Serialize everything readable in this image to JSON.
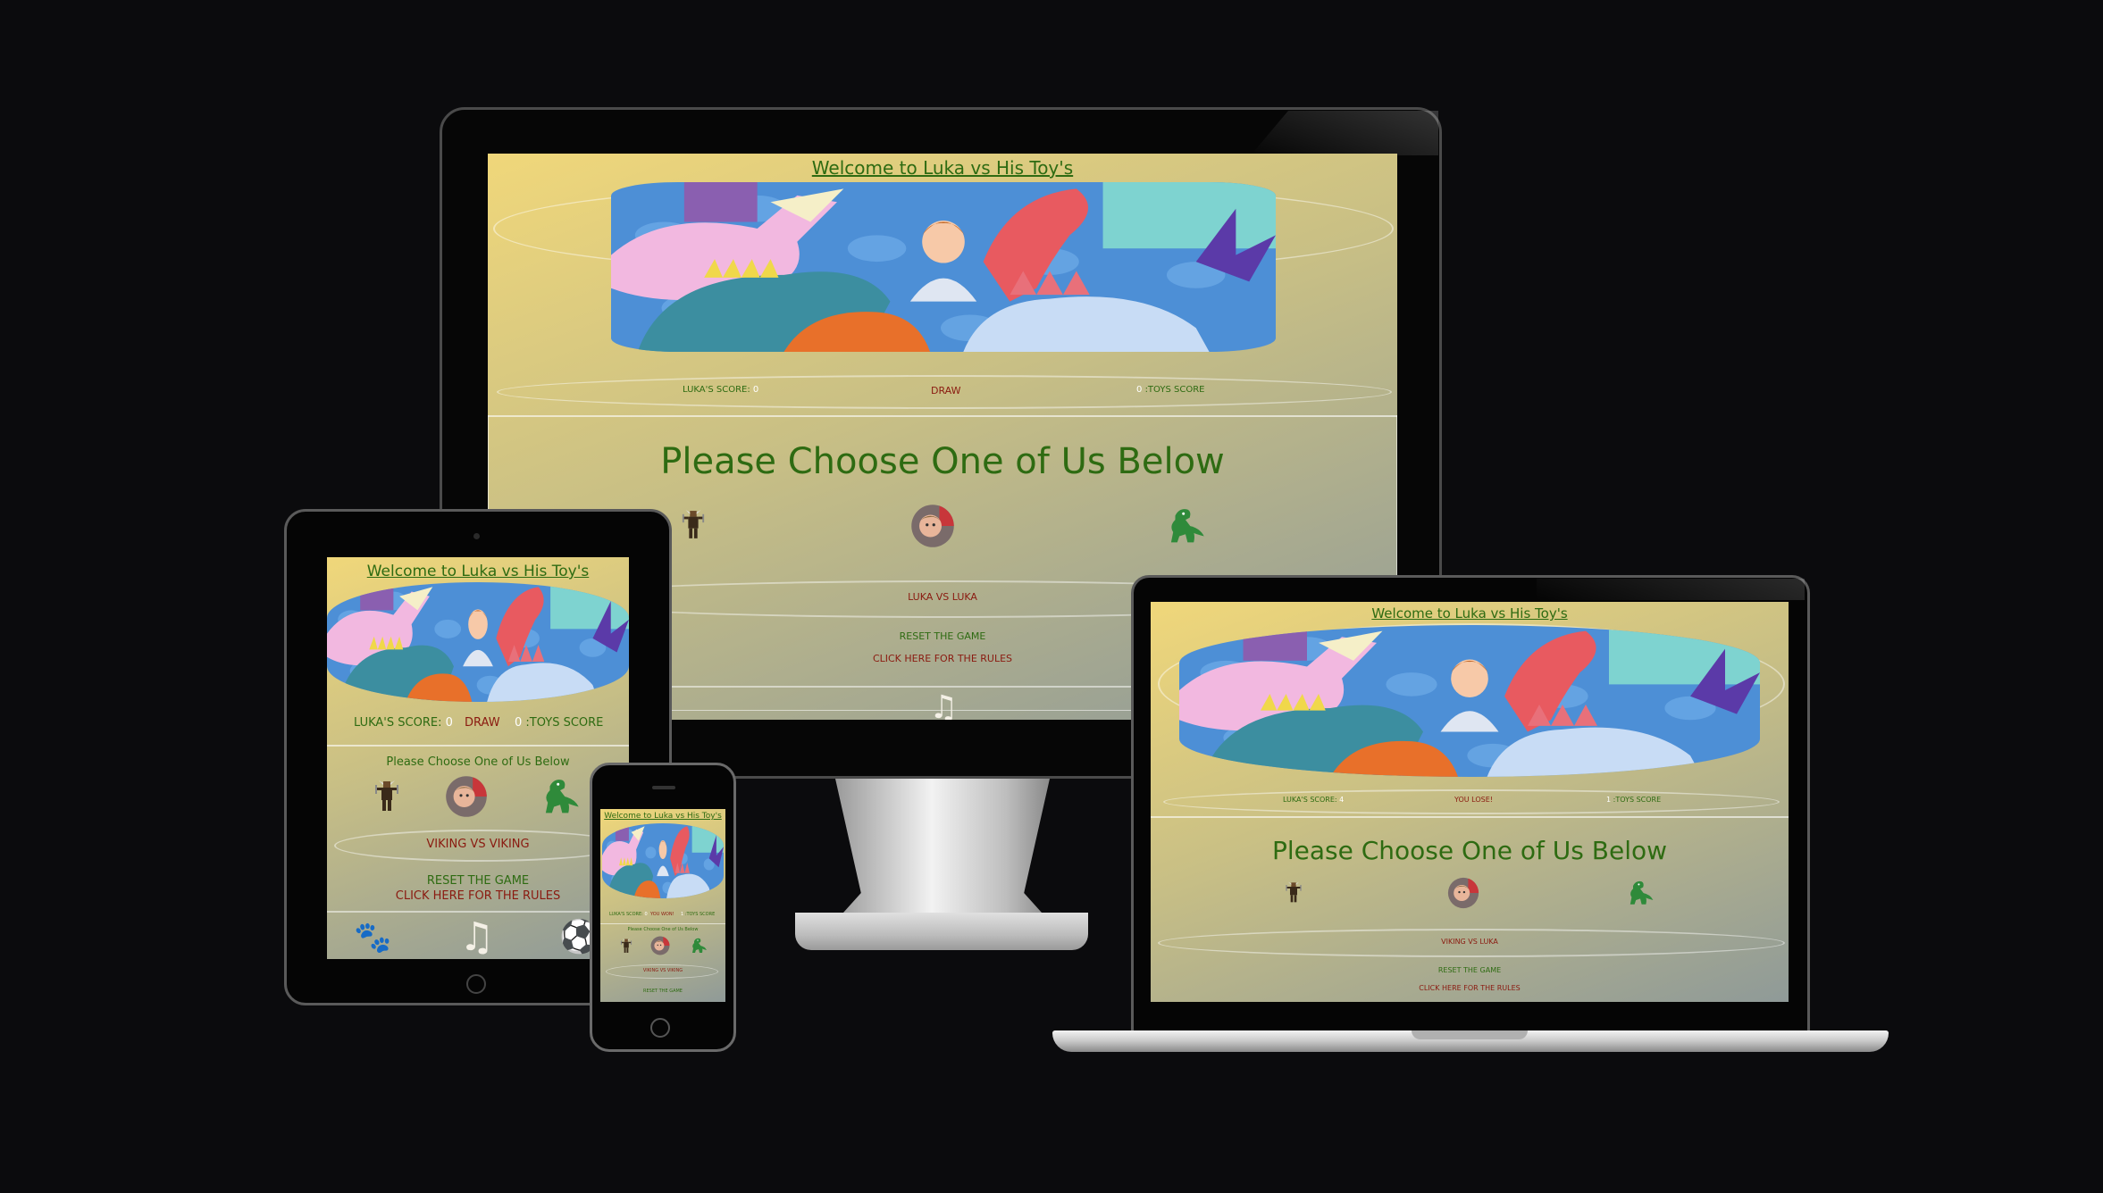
{
  "site": {
    "title": "Welcome to Luka vs His Toy's",
    "choose_heading": "Please Choose One of Us Below",
    "reset_label": "RESET THE GAME",
    "rules_label": "CLICK HERE FOR THE RULES",
    "lukas_score_label": "LUKA'S SCORE:",
    "toys_score_label": ":TOYS SCORE"
  },
  "desktop": {
    "lukas_score": "0",
    "result": "DRAW",
    "toys_score": "0",
    "matchup": "LUKA VS LUKA"
  },
  "tablet": {
    "lukas_score": "0",
    "result": "DRAW",
    "toys_score": "0",
    "matchup": "VIKING VS VIKING"
  },
  "laptop": {
    "lukas_score": "4",
    "result": "YOU LOSE!",
    "toys_score": "1",
    "matchup": "VIKING VS LUKA"
  },
  "phone": {
    "lukas_score": "0",
    "result": "YOU WON!",
    "toys_score": "1",
    "matchup": "VIKING VS VIKING"
  },
  "footer_icons": [
    "paw-icon",
    "music-note-icon",
    "soccer-ball-icon"
  ],
  "colors": {
    "background": "#0b0b0d",
    "heading_green": "#2e6b12",
    "result_red": "#8a1a10",
    "page_gradient_start": "#f0d77a",
    "page_gradient_end": "#8f9a98"
  }
}
